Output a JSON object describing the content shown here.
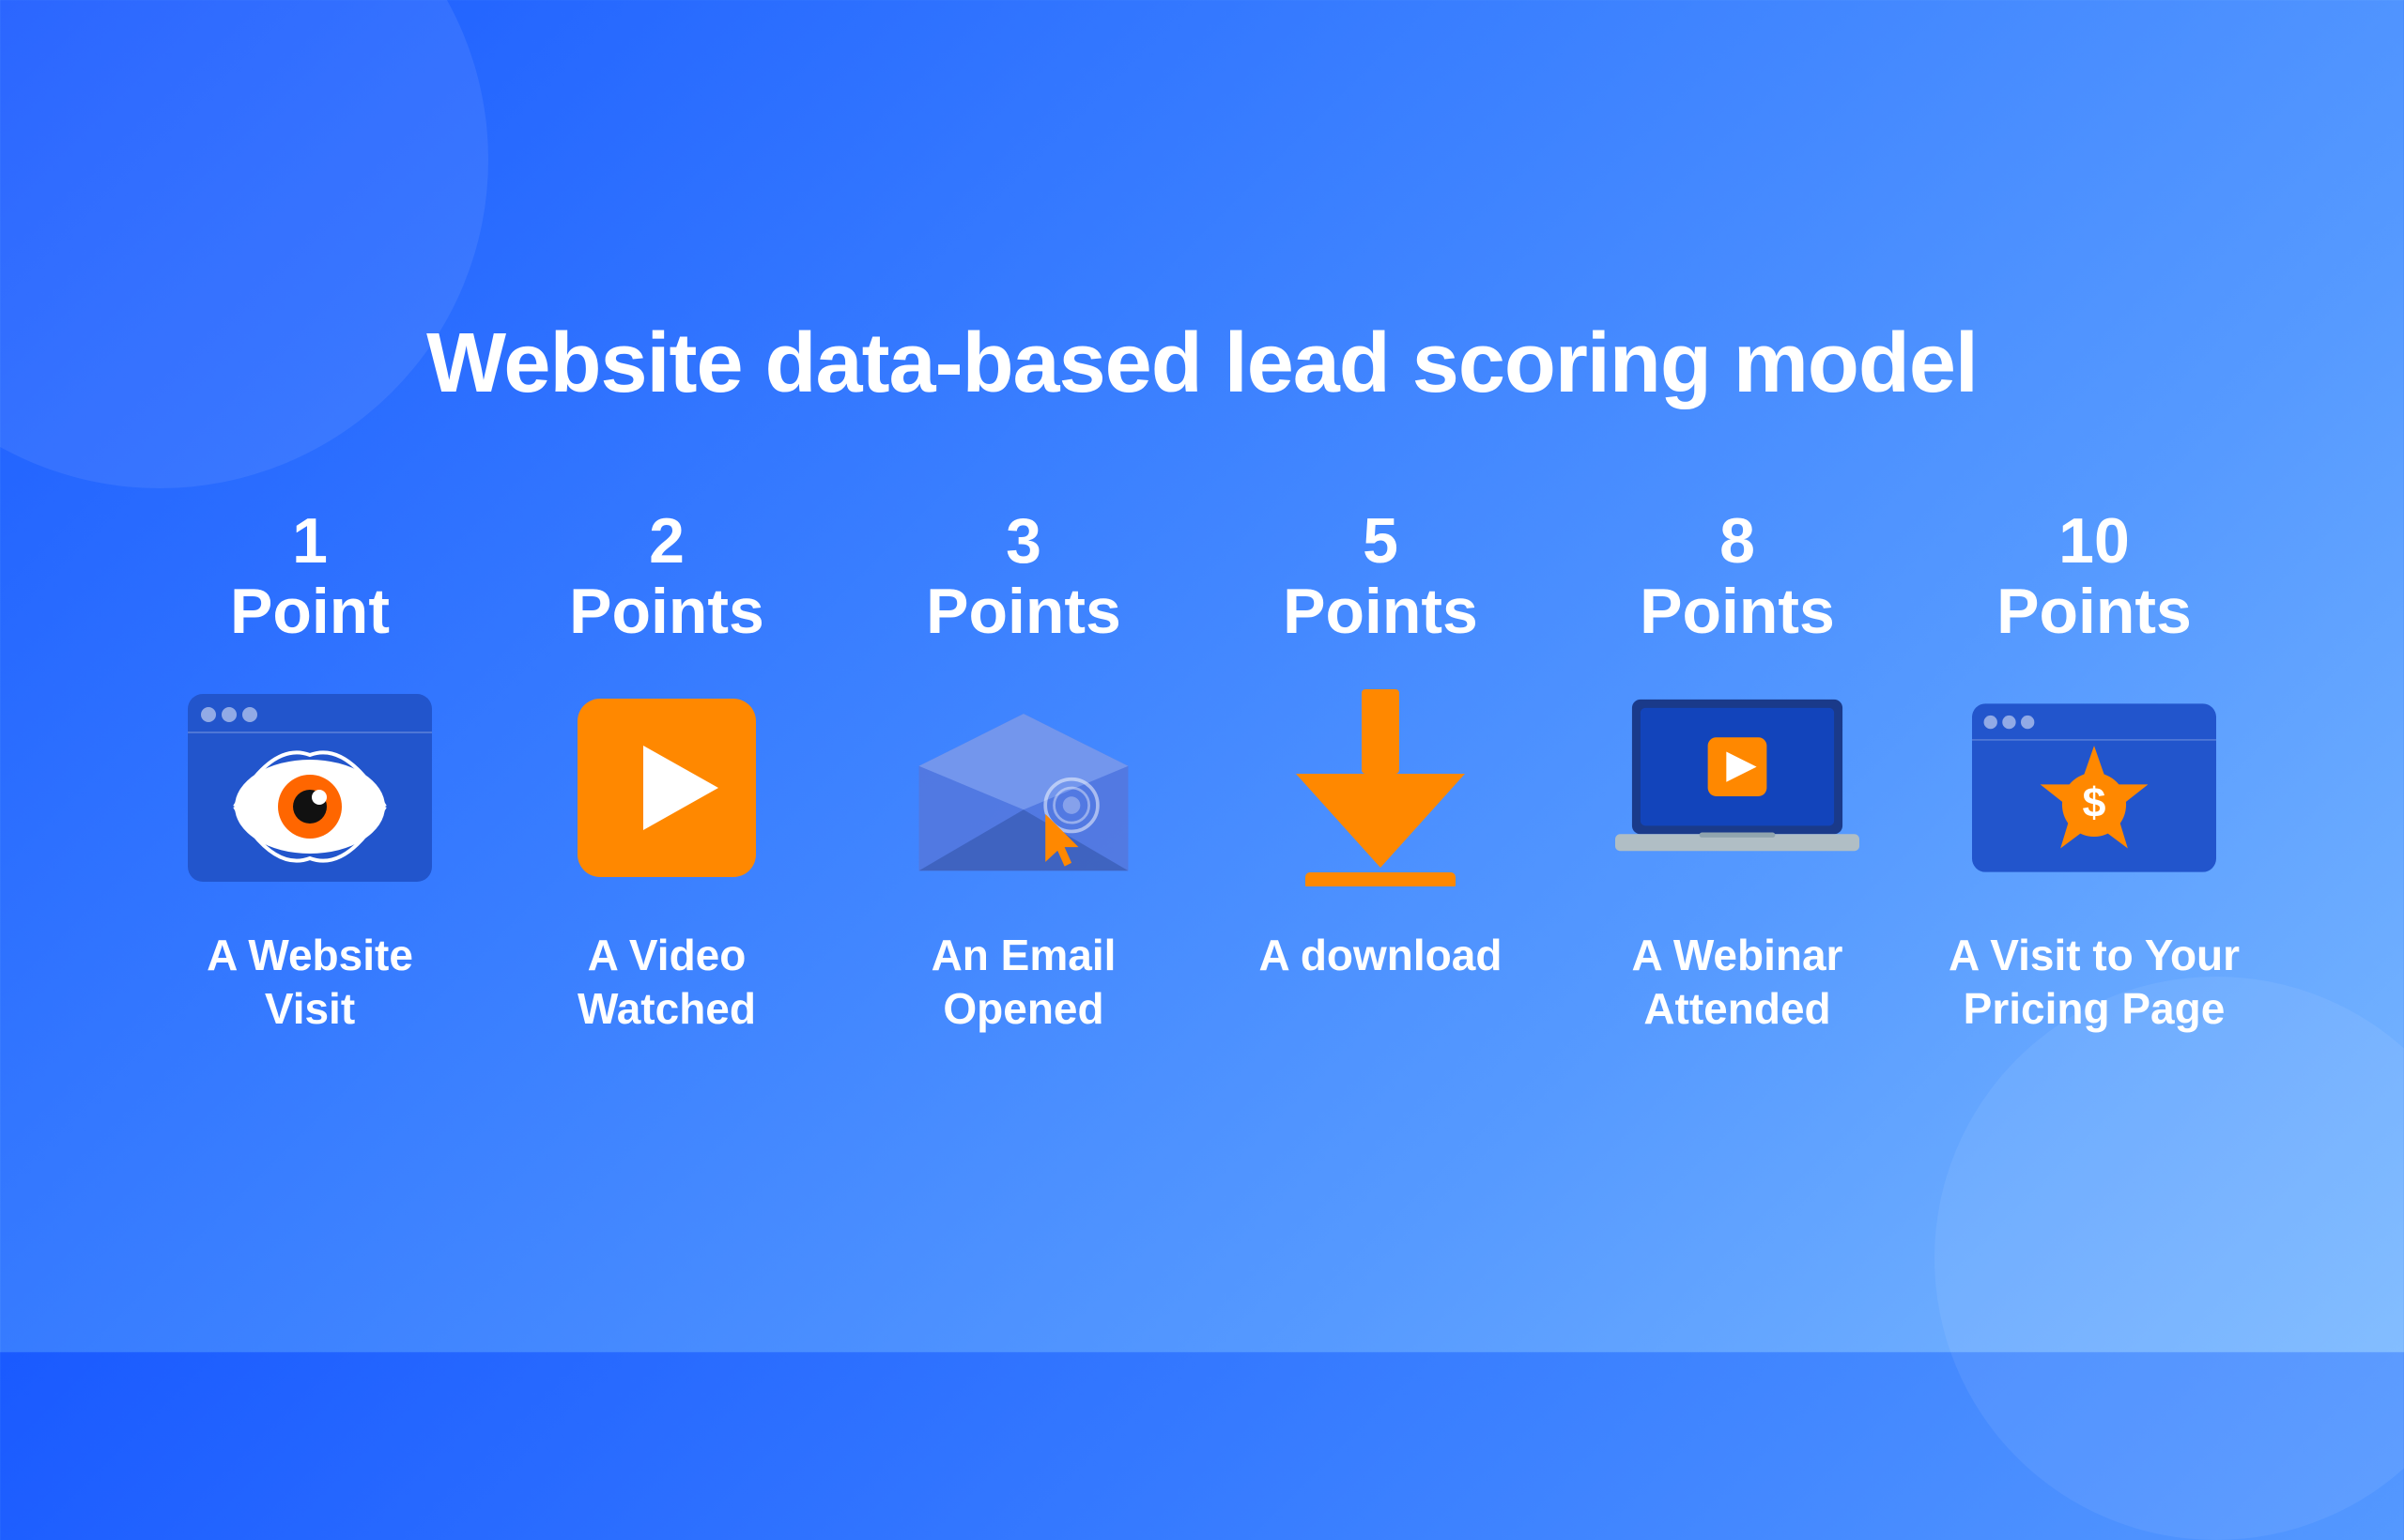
{
  "page": {
    "title": "Website data-based lead scoring model",
    "background_gradient_start": "#1a5aff",
    "background_gradient_end": "#7ab8ff"
  },
  "cards": [
    {
      "id": "website-visit",
      "points_number": "1",
      "points_label": "Point",
      "description": "A Website Visit",
      "icon": "website-visit-icon"
    },
    {
      "id": "video-watched",
      "points_number": "2",
      "points_label": "Points",
      "description": "A Video Watched",
      "icon": "video-play-icon"
    },
    {
      "id": "email-opened",
      "points_number": "3",
      "points_label": "Points",
      "description": "An Email Opened",
      "icon": "email-icon"
    },
    {
      "id": "download",
      "points_number": "5",
      "points_label": "Points",
      "description": "A download",
      "icon": "download-icon"
    },
    {
      "id": "webinar",
      "points_number": "8",
      "points_label": "Points",
      "description": "A Webinar Attended",
      "icon": "webinar-icon"
    },
    {
      "id": "pricing-page",
      "points_number": "10",
      "points_label": "Points",
      "description": "A Visit to Your Pricing Page",
      "icon": "pricing-page-icon"
    }
  ]
}
